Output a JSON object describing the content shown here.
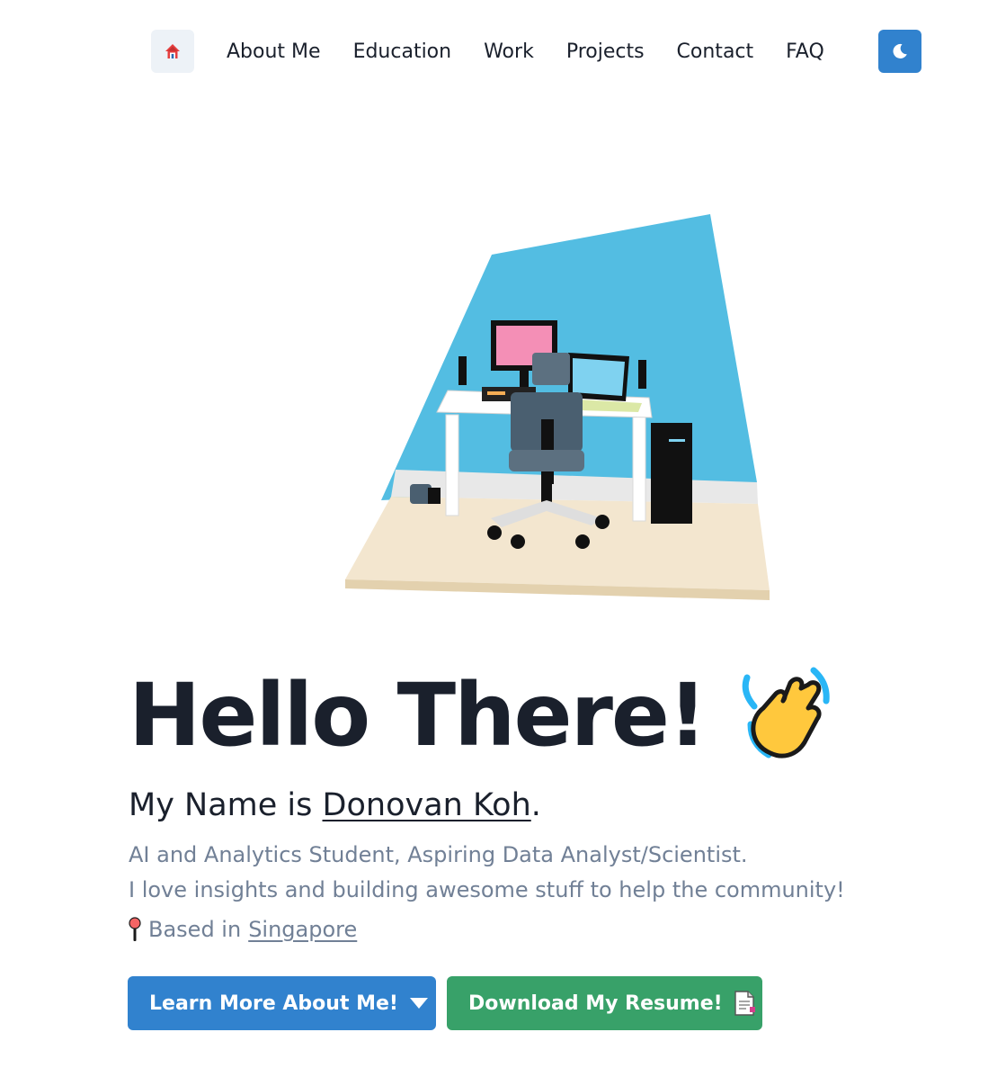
{
  "nav": {
    "home_icon": "house-icon",
    "links": [
      "About Me",
      "Education",
      "Work",
      "Projects",
      "Contact",
      "FAQ"
    ],
    "theme_toggle_icon": "moon-icon"
  },
  "hero": {
    "title": "Hello There!",
    "wave_icon": "waving-hand-icon",
    "intro_prefix": "My Name is ",
    "name": "Donovan Koh",
    "intro_suffix": ".",
    "tagline_line1": "AI and Analytics Student, Aspiring Data Analyst/Scientist.",
    "tagline_line2": "I love insights and building awesome stuff to help the community!",
    "location_prefix": "Based in",
    "location": "Singapore",
    "location_icon": "pin-icon"
  },
  "buttons": {
    "learn_more": "Learn More About Me!",
    "learn_more_icon": "caret-down-icon",
    "resume": "Download My Resume!",
    "resume_icon": "document-icon"
  },
  "colors": {
    "primary": "#3182ce",
    "success": "#38a169",
    "text": "#1a202c",
    "muted": "#718096",
    "scene_wall": "#53bde2",
    "scene_floor": "#f3e6cf"
  }
}
